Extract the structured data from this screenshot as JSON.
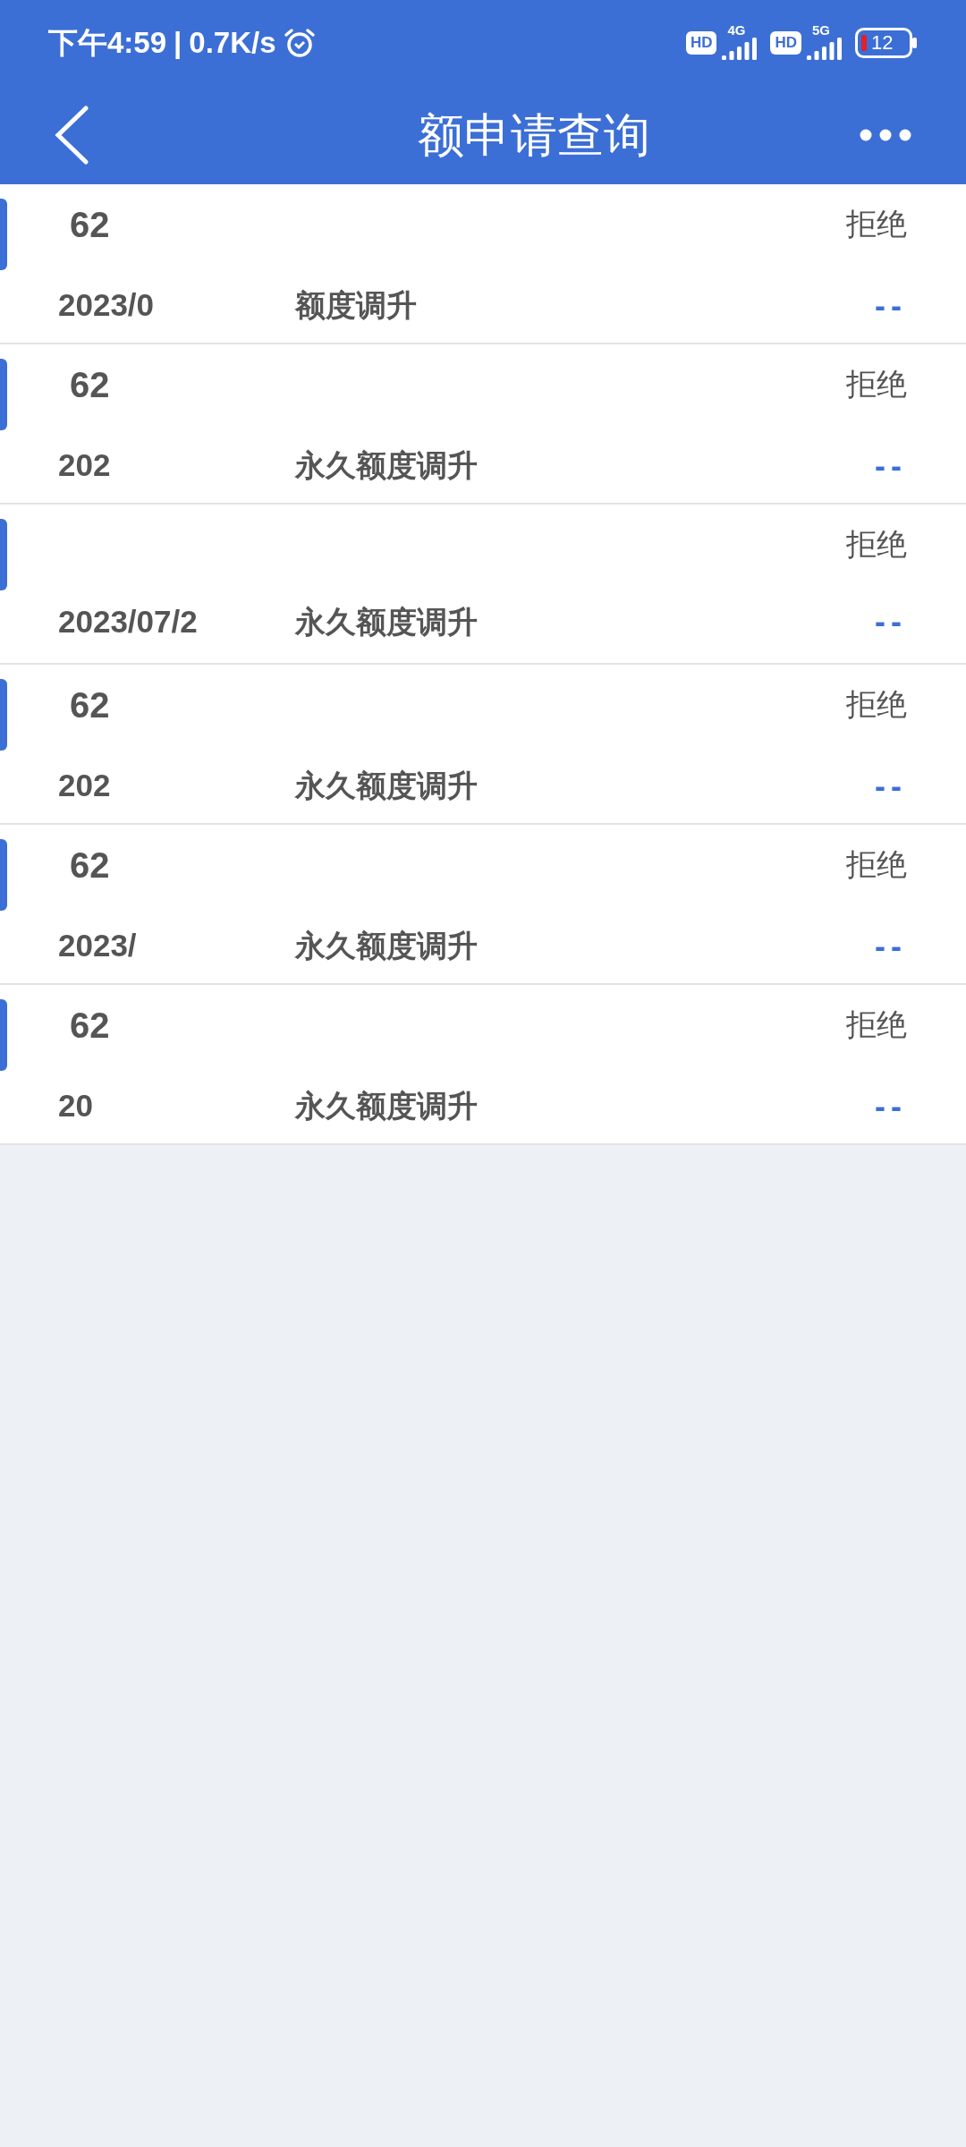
{
  "status_bar": {
    "time": "下午4:59",
    "separator": "|",
    "speed": "0.7K/s",
    "networks": [
      {
        "badge": "HD",
        "type": "4G"
      },
      {
        "badge": "HD",
        "type": "5G"
      }
    ],
    "battery": "12"
  },
  "header": {
    "title": "额申请查询"
  },
  "rows": [
    {
      "card_number": "62",
      "status": "拒绝",
      "date": "2023/0",
      "type": "额度调升",
      "amount": "--"
    },
    {
      "card_number": "62",
      "status": "拒绝",
      "date": "202",
      "type": "永久额度调升",
      "amount": "--"
    },
    {
      "status": "拒绝",
      "date": "2023/07/2",
      "type": "永久额度调升",
      "amount": "--"
    },
    {
      "card_number": "62",
      "status": "拒绝",
      "date": "202",
      "type": "永久额度调升",
      "amount": "--"
    },
    {
      "card_number": "62",
      "status": "拒绝",
      "date": "2023/",
      "type": "永久额度调升",
      "amount": "--"
    },
    {
      "card_number": "62",
      "status": "拒绝",
      "date": "20",
      "type": "永久额度调升",
      "amount": "--"
    }
  ]
}
